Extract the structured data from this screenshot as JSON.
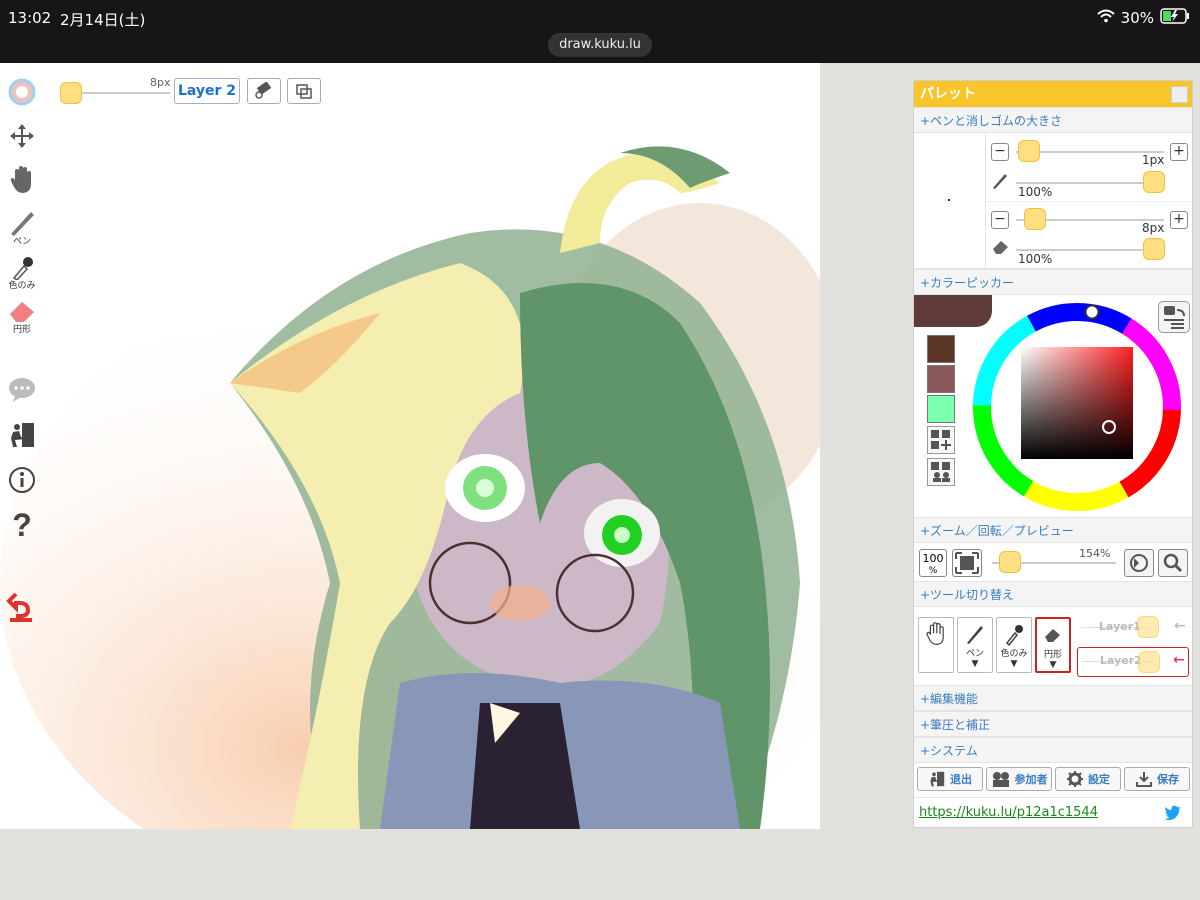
{
  "status_bar": {
    "time": "13:02",
    "date": "2月14日(土)",
    "battery": "30%",
    "url": "draw.kuku.lu"
  },
  "top_bar": {
    "brush_size": "8px",
    "layer_button": "Layer 2"
  },
  "left_tools": {
    "pen_label": "ペン",
    "eyedropper_label": "色のみ",
    "eraser_label": "円形"
  },
  "palette": {
    "title": "パレット",
    "sections": {
      "pen_eraser": "+ペンと消しゴムの大きさ",
      "color_picker": "+カラーピッカー",
      "zoom": "+ズーム／回転／プレビュー",
      "tool_switch": "+ツール切り替え",
      "edit": "+編集機能",
      "pressure": "+筆圧と補正",
      "system": "+システム"
    },
    "pen": {
      "minus": "−",
      "plus": "+",
      "size": "1px",
      "opacity": "100%"
    },
    "eraser": {
      "minus": "−",
      "plus": "+",
      "size": "8px",
      "opacity": "100%"
    },
    "swatches": [
      "#5a3424",
      "#8a5858",
      "#7dffb0"
    ],
    "current_color": "#5e3b38",
    "zoom": {
      "reset": "100",
      "reset_unit": "%",
      "level": "154%"
    },
    "tool_cards": {
      "pen": "ペン",
      "eyedropper": "色のみ",
      "eraser": "円形"
    },
    "layers": [
      {
        "label": "Layer1",
        "selected": false
      },
      {
        "label": "Layer2",
        "selected": true
      }
    ],
    "buttons": {
      "exit": "退出",
      "participants": "参加者",
      "settings": "設定",
      "save": "保存"
    },
    "share_url": "https://kuku.lu/p12a1c1544"
  }
}
